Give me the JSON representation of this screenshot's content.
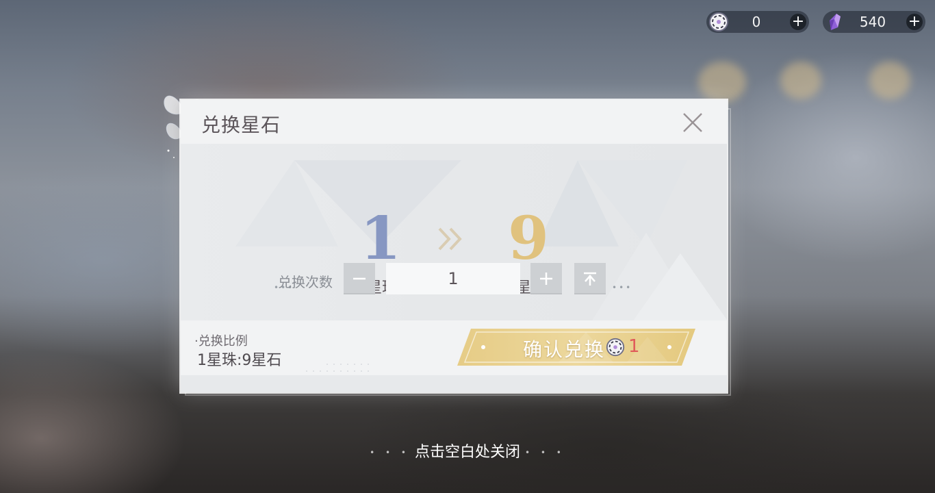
{
  "currencies": [
    {
      "name": "星珠",
      "icon": "star-orb-icon",
      "value": "0"
    },
    {
      "name": "星石",
      "icon": "star-crystal-icon",
      "value": "540"
    }
  ],
  "dialog": {
    "title": "兑换星石",
    "from_amount": "1",
    "from_currency": "星珠",
    "to_amount": "9",
    "to_currency": "星石",
    "count_label": "兑换次数",
    "count_value": "1",
    "ratio_label": "·兑换比例",
    "ratio_value": "1星珠:9星石",
    "confirm_label": "确认兑换",
    "confirm_cost": "1"
  },
  "close_hint": "点击空白处关闭",
  "colors": {
    "from_number": "#8797c2",
    "to_number": "#e0c27e",
    "confirm_button": "#e8d08a",
    "cost_red": "#e05a5a"
  }
}
